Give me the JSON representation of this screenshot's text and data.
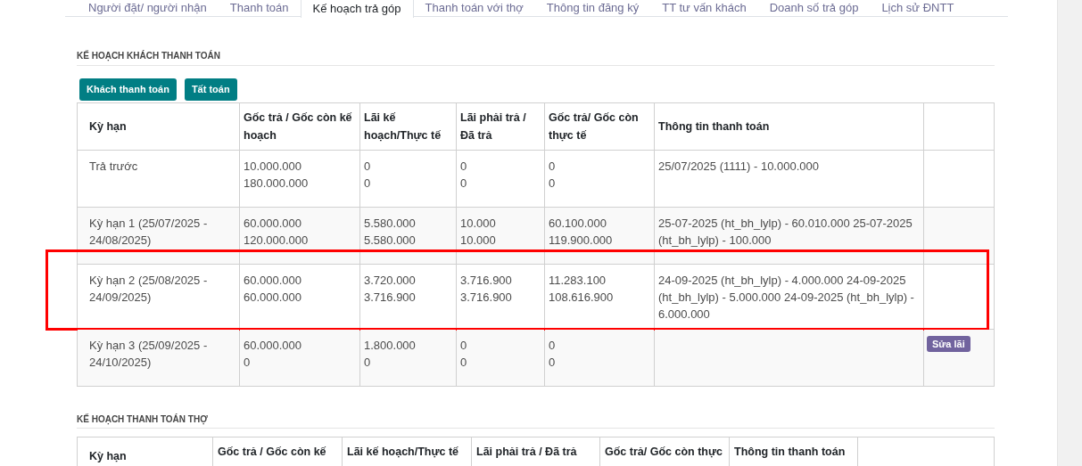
{
  "tabs": [
    {
      "label": "Người đặt/ người nhận",
      "selected": false
    },
    {
      "label": "Thanh toán",
      "selected": false
    },
    {
      "label": "Kế hoạch trả góp",
      "selected": true
    },
    {
      "label": "Thanh toán với thợ",
      "selected": false
    },
    {
      "label": "Thông tin đăng ký",
      "selected": false
    },
    {
      "label": "TT tư vấn khách",
      "selected": false
    },
    {
      "label": "Doanh số trả góp",
      "selected": false
    },
    {
      "label": "Lịch sử ĐNTT",
      "selected": false
    }
  ],
  "customer_plan": {
    "title": "KẾ HOẠCH KHÁCH THANH TOÁN",
    "buttons": [
      "Khách thanh toán",
      "Tất toán"
    ],
    "columns": [
      "Kỳ hạn",
      "Gốc trả / Gốc còn kế hoạch",
      "Lãi kế hoạch/Thực tế",
      "Lãi phải trả / Đã trả",
      "Gốc trả/ Gốc còn thực tế",
      "Thông tin thanh toán"
    ],
    "rows": [
      {
        "cells": [
          "Trả trước",
          "10.000.000\n180.000.000",
          "0\n0",
          "0\n0",
          "0\n0",
          "25/07/2025 (1111) - 10.000.000"
        ],
        "highlighted": false
      },
      {
        "cells": [
          "Kỳ hạn 1 (25/07/2025 - 24/08/2025)",
          "60.000.000\n120.000.000",
          "5.580.000\n5.580.000",
          "10.000\n10.000",
          "60.100.000\n119.900.000",
          "25-07-2025 (ht_bh_lylp) - 60.010.000 25-07-2025 (ht_bh_lylp) - 100.000"
        ],
        "highlighted": false
      },
      {
        "cells": [
          "Kỳ hạn 2 (25/08/2025 - 24/09/2025)",
          "60.000.000\n60.000.000",
          "3.720.000\n3.716.900",
          "3.716.900\n3.716.900",
          "11.283.100\n108.616.900",
          "24-09-2025 (ht_bh_lylp) - 4.000.000 24-09-2025 (ht_bh_lylp) - 5.000.000 24-09-2025 (ht_bh_lylp) - 6.000.000"
        ],
        "highlighted": true
      },
      {
        "cells": [
          "Kỳ hạn 3 (25/09/2025 - 24/10/2025)",
          "60.000.000\n0",
          "1.800.000\n0",
          "0\n0",
          "0\n0",
          ""
        ],
        "action": "Sửa lãi",
        "highlighted": false
      }
    ]
  },
  "worker_plan": {
    "title": "KẾ HOẠCH THANH TOÁN THỢ",
    "columns": [
      "Kỳ hạn",
      "Gốc trả / Gốc còn kế",
      "Lãi kế hoạch/Thực tế",
      "Lãi phải trả / Đã trả",
      "Gốc trả/ Gốc còn thực",
      "Thông tin thanh toán"
    ]
  }
}
